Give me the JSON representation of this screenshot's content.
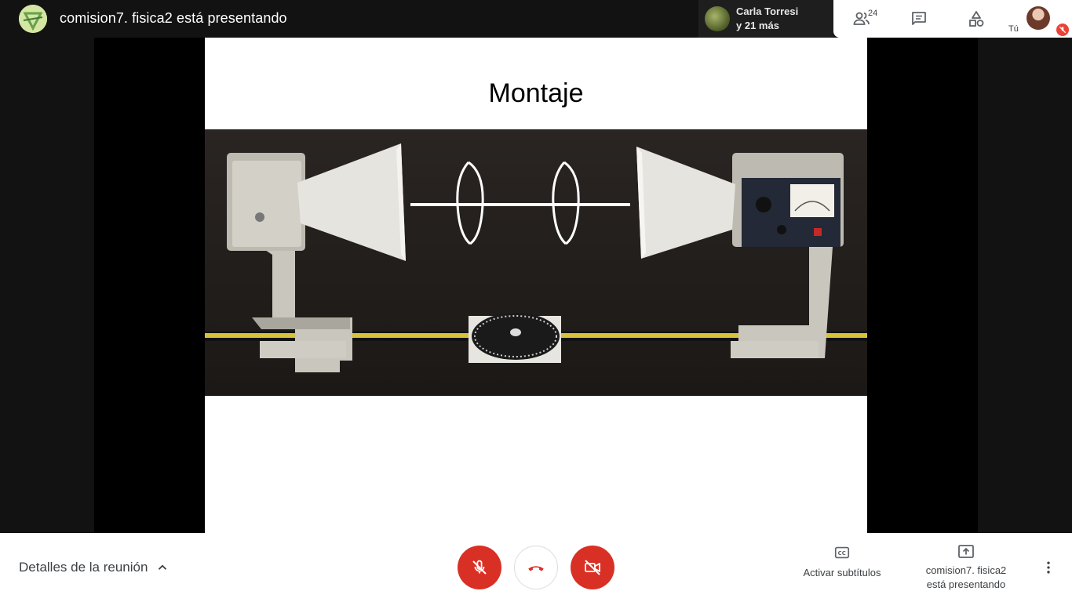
{
  "topbar": {
    "presenter_title": "comision7. fisica2 está presentando",
    "speaker_name": "Carla Torresi",
    "speaker_more": "y 21 más",
    "participants_count": "24",
    "self_label": "Tú"
  },
  "slide": {
    "title": "Montaje"
  },
  "bottombar": {
    "details_label": "Detalles de la reunión",
    "captions_label": "Activar subtítulos",
    "presenting_line1": "comision7. fisica2",
    "presenting_line2": "está presentando"
  },
  "colors": {
    "end_call_red": "#d93025",
    "mute_badge": "#ea4335",
    "topbar_bg": "#121212"
  },
  "icons": {
    "presenter": "avatar-icon",
    "participants": "people-icon",
    "chat": "chat-icon",
    "activities": "shapes-icon",
    "mic": "mic-off-icon",
    "hangup": "phone-hangup-icon",
    "camera": "videocam-off-icon",
    "captions": "closed-caption-icon",
    "present": "present-screen-icon",
    "more": "more-vert-icon"
  }
}
